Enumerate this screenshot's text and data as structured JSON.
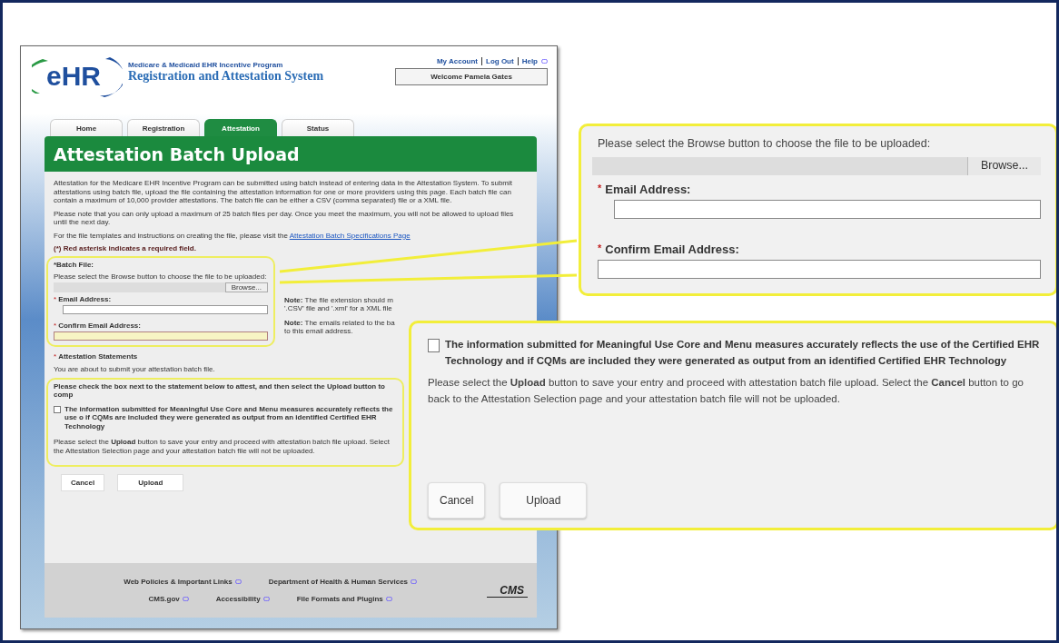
{
  "header": {
    "logo": "eHR",
    "program": "Medicare & Medicaid EHR Incentive Program",
    "system": "Registration and Attestation System",
    "links": [
      "My Account",
      "Log Out",
      "Help"
    ],
    "welcome": "Welcome Pamela Gates"
  },
  "tabs": [
    {
      "label": "Home",
      "selected": false
    },
    {
      "label": "Registration",
      "selected": false
    },
    {
      "label": "Attestation",
      "selected": true
    },
    {
      "label": "Status",
      "selected": false
    }
  ],
  "page_title": "Attestation Batch Upload",
  "intro": [
    "Attestation for the Medicare EHR Incentive Program can be submitted using batch instead of entering data in the Attestation System. To submit attestations using batch file, upload the file containing the attestation information for one or more providers using this page. Each batch file can contain a maximum of 10,000 provider attestations. The batch file can be either a CSV (comma separated) file or a XML file.",
    "Please note that you can only upload a maximum of 25 batch files per day. Once you meet the maximum, you will not be allowed to upload files until the next day."
  ],
  "templates": {
    "text": "For the file templates and instructions on creating the file, please visit the",
    "link": "Attestation Batch Specifications Page"
  },
  "required_note": "(*) Red asterisk indicates a required field.",
  "batch_file": {
    "heading": "*Batch File:",
    "instruction": "Please select the Browse button to choose the file to be uploaded:",
    "browse": "Browse...",
    "mark": "*",
    "email_label": "Email Address:",
    "confirm_label": "Confirm Email Address:"
  },
  "notes": [
    {
      "label": "Note:",
      "text": "The file extension should m '.CSV' file and '.xml' for a XML file"
    },
    {
      "label": "Note:",
      "text": "The emails related to the ba to this email address."
    }
  ],
  "statements": {
    "mark": "*",
    "heading": "Attestation Statements",
    "about": "You are about to submit your attestation batch file.",
    "instruction": "Please check the box next to the statement below to attest, and then select the Upload button to comp",
    "statement": "The information submitted for Meaningful Use Core and Menu measures accurately reflects the use o if CQMs are included they were generated as output from an identified Certified EHR Technology",
    "checked": false,
    "upload_note": "Please select the **Upload** button to save your entry and proceed with attestation batch file upload. Select the Attestation Selection page and your attestation batch file will not be uploaded.",
    "buttons": [
      "Cancel",
      "Upload"
    ]
  },
  "footer": {
    "top_links": [
      "Web Policies & Important Links",
      "Department of Health & Human Services"
    ],
    "bottom_links": [
      "CMS.gov",
      "Accessibility",
      "File Formats and Plugins"
    ],
    "logo": "CMS"
  },
  "zoom_file": {
    "instruction": "Please select the Browse button to choose the file to be uploaded:",
    "browse": "Browse...",
    "mark": "*",
    "email_label": "Email Address:",
    "confirm_label": "Confirm Email Address:"
  },
  "zoom_statement": {
    "statement": "The information submitted for Meaningful Use Core and Menu measures accurately reflects the use of the Certified EHR Technology and if CQMs are included they were generated as output from an identified Certified EHR Technology",
    "checked": false,
    "upload_note": "Please select the **Upload** button to save your entry and proceed with attestation batch file upload. Select the **Cancel** button to go back to the Attestation Selection page and your attestation batch file will not be uploaded.",
    "buttons": [
      "Cancel",
      "Upload"
    ]
  }
}
